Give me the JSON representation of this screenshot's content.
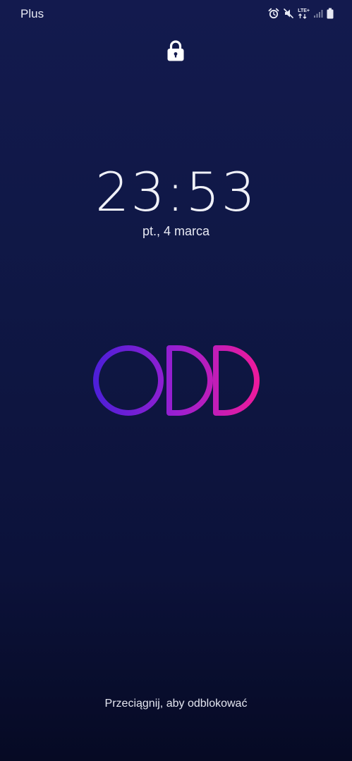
{
  "status_bar": {
    "carrier": "Plus",
    "network_type": "LTE+",
    "icons": [
      "alarm-icon",
      "mute-icon",
      "lte-icon",
      "signal-icon",
      "battery-icon"
    ]
  },
  "lock_screen": {
    "lock_icon": "lock-icon",
    "time": "23:53",
    "date": "pt., 4 marca",
    "unlock_hint": "Przeciągnij, aby odblokować"
  },
  "logo": {
    "gradient_start": "#4a1fd8",
    "gradient_mid": "#9a1fd0",
    "gradient_end": "#f01a9a"
  },
  "colors": {
    "background_top": "#131a4e",
    "background_bottom": "#060a24"
  }
}
